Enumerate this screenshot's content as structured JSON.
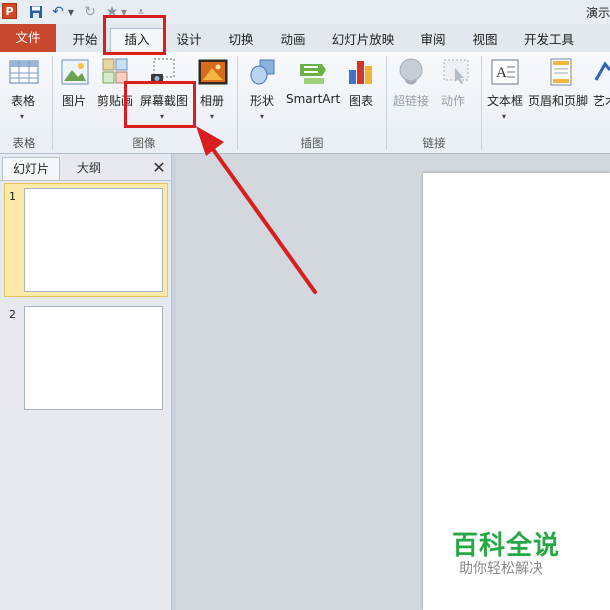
{
  "window": {
    "title": "演示"
  },
  "quick_access": {
    "logo": "P",
    "save_icon": "save-icon",
    "undo_icon": "undo-icon",
    "redo_icon": "redo-icon",
    "star_icon": "star-icon"
  },
  "tabs": [
    {
      "id": "file",
      "label": "文件"
    },
    {
      "id": "home",
      "label": "开始"
    },
    {
      "id": "insert",
      "label": "插入"
    },
    {
      "id": "design",
      "label": "设计"
    },
    {
      "id": "transitions",
      "label": "切换"
    },
    {
      "id": "animations",
      "label": "动画"
    },
    {
      "id": "slideshow",
      "label": "幻灯片放映"
    },
    {
      "id": "review",
      "label": "审阅"
    },
    {
      "id": "view",
      "label": "视图"
    },
    {
      "id": "developer",
      "label": "开发工具"
    }
  ],
  "active_tab": "插入",
  "ribbon": {
    "groups": [
      {
        "label": "表格",
        "buttons": [
          {
            "label": "表格",
            "icon": "table-icon"
          }
        ]
      },
      {
        "label": "图像",
        "buttons": [
          {
            "label": "图片",
            "icon": "picture-icon"
          },
          {
            "label": "剪贴画",
            "icon": "clipart-icon"
          },
          {
            "label": "屏幕截图",
            "icon": "screenshot-icon"
          },
          {
            "label": "相册",
            "icon": "photo-album-icon"
          }
        ]
      },
      {
        "label": "插图",
        "buttons": [
          {
            "label": "形状",
            "icon": "shapes-icon"
          },
          {
            "label": "SmartArt",
            "icon": "smartart-icon"
          },
          {
            "label": "图表",
            "icon": "chart-icon"
          }
        ]
      },
      {
        "label": "链接",
        "buttons": [
          {
            "label": "超链接",
            "icon": "hyperlink-icon",
            "disabled": true
          },
          {
            "label": "动作",
            "icon": "action-icon",
            "disabled": true
          }
        ]
      },
      {
        "label": "",
        "buttons": [
          {
            "label": "文本框",
            "icon": "textbox-icon"
          },
          {
            "label": "页眉和页脚",
            "icon": "header-footer-icon"
          },
          {
            "label": "艺术",
            "icon": "wordart-icon"
          }
        ]
      }
    ]
  },
  "slide_panel": {
    "tabs": [
      {
        "label": "幻灯片"
      },
      {
        "label": "大纲"
      }
    ],
    "close_symbol": "✕",
    "slides": [
      {
        "number": "1",
        "selected": true
      },
      {
        "number": "2",
        "selected": false
      }
    ]
  },
  "watermark": {
    "title": "百科全说",
    "subtitle": "助你轻松解决"
  },
  "colors": {
    "file_tab": "#c8482d",
    "annotation_red": "#d81e1e",
    "watermark_green": "#27a844",
    "selected_slide": "#fde9a8"
  }
}
